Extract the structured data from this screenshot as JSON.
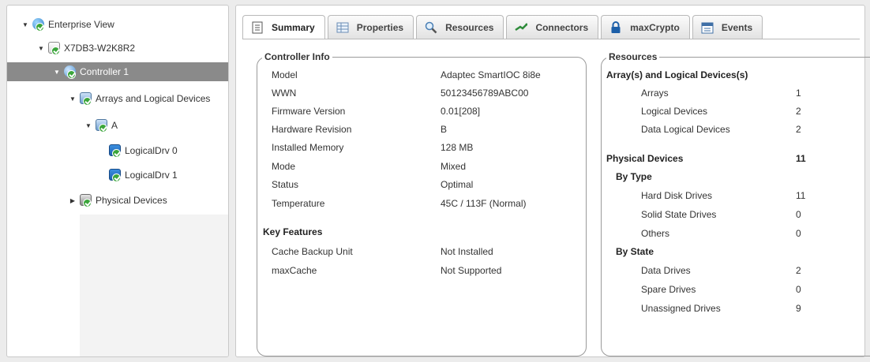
{
  "tree": {
    "enterprise": "Enterprise View",
    "server": "X7DB3-W2K8R2",
    "controller": "Controller 1",
    "arrays": "Arrays and Logical Devices",
    "array_a": "A",
    "ld0": "LogicalDrv 0",
    "ld1": "LogicalDrv 1",
    "physical": "Physical Devices"
  },
  "tabs": [
    {
      "label": "Summary",
      "icon": "document-icon"
    },
    {
      "label": "Properties",
      "icon": "properties-grid-icon"
    },
    {
      "label": "Resources",
      "icon": "magnifier-icon"
    },
    {
      "label": "Connectors",
      "icon": "connector-icon"
    },
    {
      "label": "maxCrypto",
      "icon": "lock-icon"
    },
    {
      "label": "Events",
      "icon": "calendar-icon"
    }
  ],
  "controller_info": {
    "legend": "Controller Info",
    "rows": [
      {
        "label": "Model",
        "value": "Adaptec SmartIOC 8i8e"
      },
      {
        "label": "WWN",
        "value": "50123456789ABC00"
      },
      {
        "label": "Firmware Version",
        "value": "0.01[208]"
      },
      {
        "label": "Hardware Revision",
        "value": "B"
      },
      {
        "label": "Installed Memory",
        "value": "128 MB"
      },
      {
        "label": "Mode",
        "value": "Mixed"
      },
      {
        "label": "Status",
        "value": "Optimal"
      },
      {
        "label": "Temperature",
        "value": "45C / 113F (Normal)"
      }
    ],
    "key_features_title": "Key Features",
    "key_features": [
      {
        "label": "Cache Backup Unit",
        "value": "Not Installed"
      },
      {
        "label": "maxCache",
        "value": "Not Supported"
      }
    ]
  },
  "resources": {
    "legend": "Resources",
    "arrays_title": "Array(s) and Logical Devices(s)",
    "arrays_rows": [
      {
        "label": "Arrays",
        "value": "1"
      },
      {
        "label": "Logical Devices",
        "value": "2"
      },
      {
        "label": "Data Logical Devices",
        "value": "2"
      }
    ],
    "physical_title": "Physical Devices",
    "physical_total": "11",
    "by_type_title": "By Type",
    "by_type_rows": [
      {
        "label": "Hard Disk Drives",
        "value": "11"
      },
      {
        "label": "Solid State Drives",
        "value": "0"
      },
      {
        "label": "Others",
        "value": "0"
      }
    ],
    "by_state_title": "By State",
    "by_state_rows": [
      {
        "label": "Data Drives",
        "value": "2"
      },
      {
        "label": "Spare Drives",
        "value": "0"
      },
      {
        "label": "Unassigned Drives",
        "value": "9"
      }
    ]
  },
  "colors": {
    "selected_row": "#8a8a8a",
    "status_check": "#3aa53a",
    "panel_border": "#c9c9c9"
  }
}
